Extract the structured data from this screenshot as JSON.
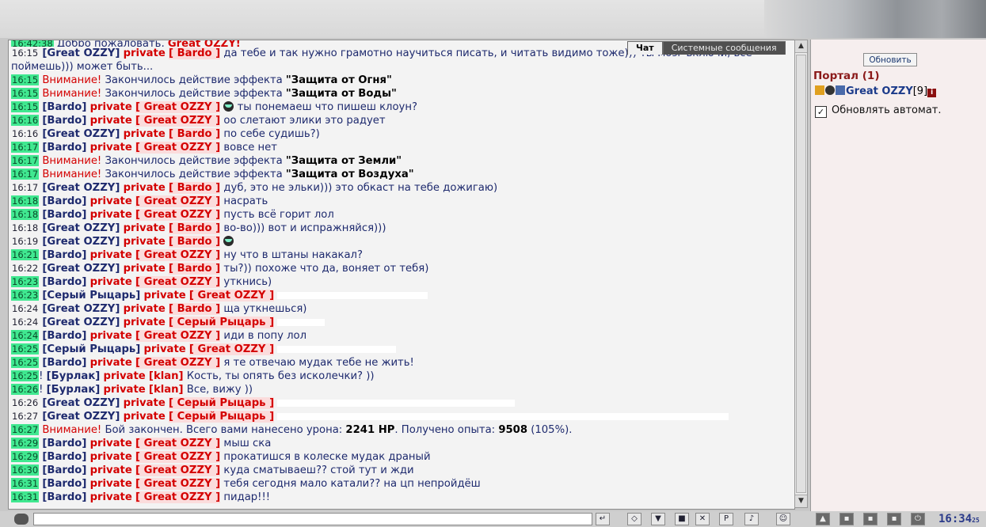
{
  "tabs": {
    "chat": "Чат",
    "system": "Системные сообщения"
  },
  "side": {
    "refresh": "Обновить",
    "portal": "Портал (1)",
    "user": {
      "name": "Great OZZY",
      "level": "[9]"
    },
    "auto": "Обновлять автомат."
  },
  "clock": {
    "time": "16:34",
    "sec": "25"
  },
  "chat": {
    "first": {
      "time": "16:42:38",
      "text": "Добро пожаловать, ",
      "name": "Great OZZY!"
    },
    "l1": {
      "time": "16:15",
      "name": "[Great OZZY]",
      "pv": "private",
      "tag": "[ Bardo ]",
      "text": "да тебе и так нужно грамотно научиться писать, и читать видимо тоже))) ты мозг включи, все поймешь))) может быть..."
    },
    "l2": {
      "time": "16:15",
      "warn": "Внимание!",
      "text": "Закончилось действие эффекта",
      "eff": "\"Защита от Огня\""
    },
    "l3": {
      "time": "16:15",
      "warn": "Внимание!",
      "text": "Закончилось действие эффекта",
      "eff": "\"Защита от Воды\""
    },
    "l4": {
      "time": "16:15",
      "name": "[Bardo]",
      "pv": "private",
      "tag": "[ Great OZZY ]",
      "text": "ты понемаеш что пишеш клоун?"
    },
    "l5": {
      "time": "16:16",
      "name": "[Bardo]",
      "pv": "private",
      "tag": "[ Great OZZY ]",
      "text": "оо слетают элики это радует"
    },
    "l6": {
      "time": "16:16",
      "name": "[Great OZZY]",
      "pv": "private",
      "tag": "[ Bardo ]",
      "text": "по себе судишь?)"
    },
    "l7": {
      "time": "16:17",
      "name": "[Bardo]",
      "pv": "private",
      "tag": "[ Great OZZY ]",
      "text": "вовсе нет"
    },
    "l8": {
      "time": "16:17",
      "warn": "Внимание!",
      "text": "Закончилось действие эффекта",
      "eff": "\"Защита от Земли\""
    },
    "l9": {
      "time": "16:17",
      "warn": "Внимание!",
      "text": "Закончилось действие эффекта",
      "eff": "\"Защита от Воздуха\""
    },
    "l10": {
      "time": "16:17",
      "name": "[Great OZZY]",
      "pv": "private",
      "tag": "[ Bardo ]",
      "text": "дуб, это не эльки))) это обкаст на тебе дожигаю)"
    },
    "l11": {
      "time": "16:18",
      "name": "[Bardo]",
      "pv": "private",
      "tag": "[ Great OZZY ]",
      "text": "насрать"
    },
    "l12": {
      "time": "16:18",
      "name": "[Bardo]",
      "pv": "private",
      "tag": "[ Great OZZY ]",
      "text": "пусть всё горит лол"
    },
    "l13": {
      "time": "16:18",
      "name": "[Great OZZY]",
      "pv": "private",
      "tag": "[ Bardo ]",
      "text": "во-во))) вот и испражняйся)))"
    },
    "l14": {
      "time": "16:19",
      "name": "[Great OZZY]",
      "pv": "private",
      "tag": "[ Bardo ]"
    },
    "l15": {
      "time": "16:21",
      "name": "[Bardo]",
      "pv": "private",
      "tag": "[ Great OZZY ]",
      "text": "ну что в штаны накакал?"
    },
    "l16": {
      "time": "16:22",
      "name": "[Great OZZY]",
      "pv": "private",
      "tag": "[ Bardo ]",
      "text": "ты?)) похоже что да, воняет от тебя)"
    },
    "l17": {
      "time": "16:23",
      "name": "[Bardo]",
      "pv": "private",
      "tag": "[ Great OZZY ]",
      "text": "уткнись)"
    },
    "l18": {
      "time": "16:23",
      "name": "[Серый Рыцарь]",
      "pv": "private",
      "tag": "[ Great OZZY ]"
    },
    "l19": {
      "time": "16:24",
      "name": "[Great OZZY]",
      "pv": "private",
      "tag": "[ Bardo ]",
      "text": "ща уткнешься)"
    },
    "l20": {
      "time": "16:24",
      "name": "[Great OZZY]",
      "pv": "private",
      "tag": "[ Серый Рыцарь ]"
    },
    "l21": {
      "time": "16:24",
      "name": "[Bardo]",
      "pv": "private",
      "tag": "[ Great OZZY ]",
      "text": "иди в попу лол"
    },
    "l22": {
      "time": "16:25",
      "name": "[Серый Рыцарь]",
      "pv": "private",
      "tag": "[ Great OZZY ]"
    },
    "l23": {
      "time": "16:25",
      "name": "[Bardo]",
      "pv": "private",
      "tag": "[ Great OZZY ]",
      "text": "я те отвечаю мудак тебе не жить!"
    },
    "l24": {
      "time": "16:25",
      "name": "[Бурлак]",
      "pv": "private",
      "tag": "[klan]",
      "text": "Кость, ты опять без исколечки? ))"
    },
    "l25": {
      "time": "16:26",
      "name": "[Бурлак]",
      "pv": "private",
      "tag": "[klan]",
      "text": "Все, вижу ))"
    },
    "l26": {
      "time": "16:26",
      "name": "[Great OZZY]",
      "pv": "private",
      "tag": "[ Серый Рыцарь ]"
    },
    "l27": {
      "time": "16:27",
      "name": "[Great OZZY]",
      "pv": "private",
      "tag": "[ Серый Рыцарь ]"
    },
    "l28": {
      "time": "16:27",
      "warn": "Внимание!",
      "text": "Бой закончен. Всего вами нанесено урона:",
      "dmg": "2241 HP",
      "text2": ". Получено опыта:",
      "exp": "9508",
      "text3": "(105%)."
    },
    "l29": {
      "time": "16:29",
      "name": "[Bardo]",
      "pv": "private",
      "tag": "[ Great OZZY ]",
      "text": "мыш ска"
    },
    "l30": {
      "time": "16:29",
      "name": "[Bardo]",
      "pv": "private",
      "tag": "[ Great OZZY ]",
      "text": "прокатишся в колеске мудак драный"
    },
    "l31": {
      "time": "16:30",
      "name": "[Bardo]",
      "pv": "private",
      "tag": "[ Great OZZY ]",
      "text": "куда сматываеш?? стой тут и жди"
    },
    "l32": {
      "time": "16:31",
      "name": "[Bardo]",
      "pv": "private",
      "tag": "[ Great OZZY ]",
      "text": "тебя сегодня мало катали?? на цп непройдёш"
    },
    "l33": {
      "time": "16:31",
      "name": "[Bardo]",
      "pv": "private",
      "tag": "[ Great OZZY ]",
      "text": "пидар!!!"
    }
  }
}
